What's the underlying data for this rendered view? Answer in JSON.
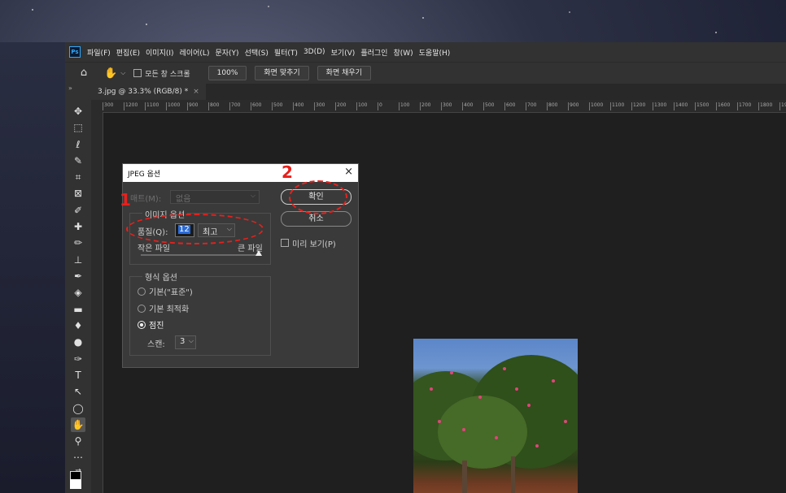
{
  "menubar": {
    "logo": "Ps",
    "items": [
      "파일(F)",
      "편집(E)",
      "이미지(I)",
      "레이어(L)",
      "문자(Y)",
      "선택(S)",
      "필터(T)",
      "3D(D)",
      "보기(V)",
      "플러그인",
      "창(W)",
      "도움말(H)"
    ]
  },
  "options": {
    "scroll_all_label": "모든 창 스크롤",
    "zoom_value": "100%",
    "fit_screen_label": "화면 맞추기",
    "fill_screen_label": "화면 채우기"
  },
  "document": {
    "tab_title": "3.jpg @ 33.3% (RGB/8) *",
    "tab_close": "×"
  },
  "ruler": {
    "top_ticks": [
      "300",
      "1200",
      "1100",
      "1000",
      "900",
      "800",
      "700",
      "600",
      "500",
      "400",
      "300",
      "200",
      "100",
      "0",
      "100",
      "200",
      "300",
      "400",
      "500",
      "600",
      "700",
      "800",
      "900",
      "1000",
      "1100",
      "1200",
      "1300",
      "1400",
      "1500",
      "1600",
      "1700",
      "1800",
      "19"
    ]
  },
  "dialog": {
    "title": "JPEG 옵션",
    "close": "×",
    "matte_label": "매트(M):",
    "matte_value": "없음",
    "image_options_label": "이미지 옵션",
    "quality_label": "품질(Q):",
    "quality_value": "12",
    "quality_preset": "최고",
    "small_file_label": "작은 파일",
    "large_file_label": "큰 파일",
    "format_options_label": "형식 옵션",
    "format_options": [
      "기본(\"표준\")",
      "기본 최적화",
      "점진"
    ],
    "selected_format": "점진",
    "scan_label": "스캔:",
    "scan_value": "3",
    "ok_label": "확인",
    "cancel_label": "취소",
    "preview_label": "미리 보기(P)"
  },
  "annotations": {
    "step1": "1",
    "step2": "2",
    "color": "#e8201c"
  },
  "colors": {
    "app_bg": "#1e1e1e",
    "panel": "#323232",
    "dialog_bg": "#3a3a3a",
    "selection_blue": "#2a6bd8"
  }
}
